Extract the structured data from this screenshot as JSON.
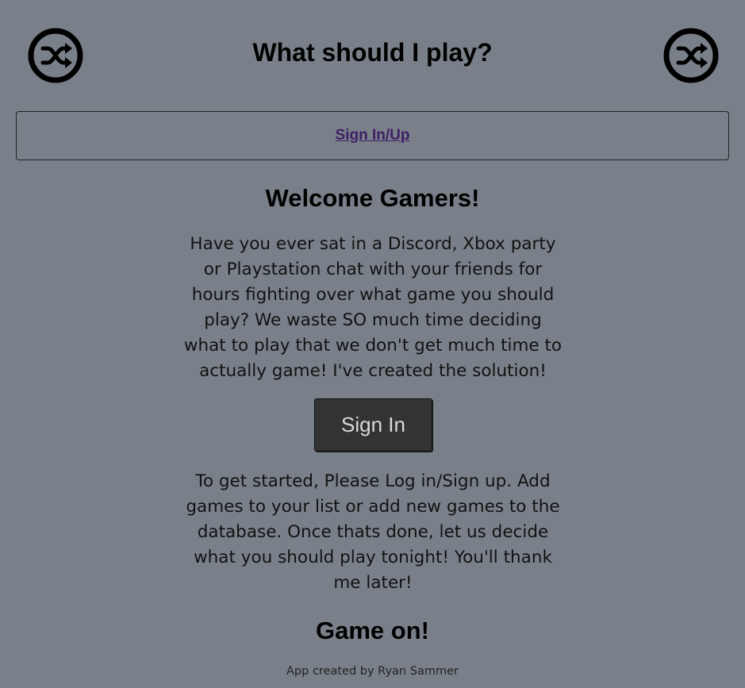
{
  "header": {
    "title": "What should I play?",
    "left_icon": "shuffle-icon",
    "right_icon": "shuffle-icon"
  },
  "nav": {
    "signup_link": "Sign In/Up"
  },
  "main": {
    "welcome": "Welcome Gamers!",
    "intro": "Have you ever sat in a Discord, Xbox party or Playstation chat with your friends for hours fighting over what game you should play? We waste SO much time deciding what to play that we don't get much time to actually game! I've created the solution!",
    "signin_button": "Sign In",
    "instructions": "To get started, Please Log in/Sign up. Add games to your list or add new games to the database. Once thats done, let us decide what you should play tonight! You'll thank me later!",
    "closing": "Game on!"
  },
  "footer": {
    "credit": "App created by Ryan Sammer"
  },
  "colors": {
    "background": "#7a8089",
    "button_bg": "#333333",
    "button_text": "#d9d9d9",
    "link": "#3f1f66"
  }
}
